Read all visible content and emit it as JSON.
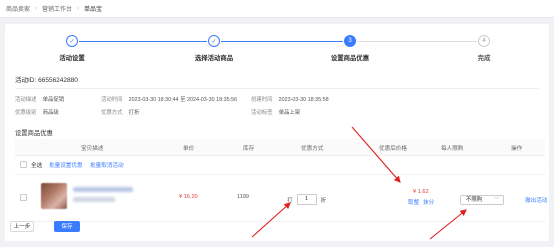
{
  "breadcrumb": [
    "商品卖家",
    "营销工作台",
    "单品宝"
  ],
  "colors": {
    "accent": "#3b7cff",
    "price_red": "#e4393c",
    "arrow_red": "#e02020"
  },
  "steps": [
    {
      "icon": "check-icon",
      "glyph": "✓",
      "label": "活动设置",
      "state": "done"
    },
    {
      "icon": "check-icon",
      "glyph": "✓",
      "label": "选择活动商品",
      "state": "done"
    },
    {
      "icon": "",
      "glyph": "3",
      "label": "设置商品优惠",
      "state": "current"
    },
    {
      "icon": "",
      "glyph": "4",
      "label": "完成",
      "state": "todo"
    }
  ],
  "activity_id": "活动ID: 66556242880",
  "info": {
    "type_label": "活动描述",
    "type_value": "单品促销",
    "time_label": "活动时间",
    "time_value": "2023-03-30 18:30:44 至 2024-03-30 18:35:56",
    "created_label": "创建时间",
    "created_value": "2023-03-30 18:35:58",
    "level_label": "优惠级别",
    "level_value": "商品级",
    "method_label": "优惠方式",
    "method_value": "打折",
    "tag_label": "活动标签",
    "tag_value": "单品上架"
  },
  "section_title": "设置商品优惠",
  "table": {
    "headers": [
      "宝贝描述",
      "单价",
      "库存",
      "优惠方式",
      "优惠后价格",
      "每人限购",
      "操作"
    ],
    "bulk": {
      "select_all": "全选",
      "batch_set": "批量设置优惠",
      "batch_cancel": "批量取消活动"
    },
    "row": {
      "price": "¥ 16.20",
      "stock": "1199",
      "discount_prefix": "打",
      "discount_value": "1",
      "discount_suffix": "折",
      "after_price": "¥ 1.62",
      "after_link1": "取整",
      "after_link2": "抹分",
      "limit": "不限购",
      "action": "撤出活动"
    }
  },
  "footer": {
    "prev": "上一步",
    "save": "保存"
  }
}
